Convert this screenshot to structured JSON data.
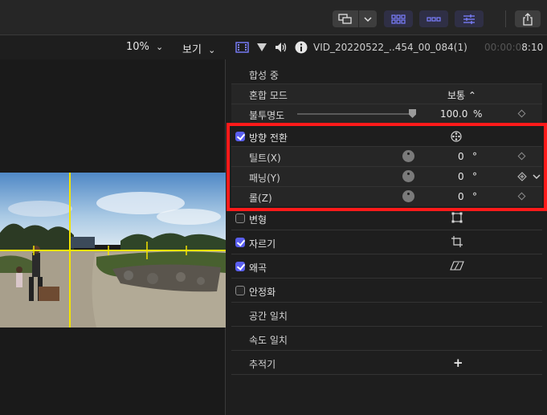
{
  "viewer": {
    "zoom": "10%",
    "zoom_caret": "⌄",
    "view_menu": "보기",
    "view_caret": "⌄"
  },
  "inspector": {
    "clip_name": "VID_20220522_..454_00_084(1)",
    "timecode_dim": "00:00:0",
    "timecode_bright": "8:10",
    "compositing": {
      "title": "합성 중",
      "blend_mode_label": "혼합 모드",
      "blend_mode_value": "보통 ⌃",
      "opacity_label": "불투명도",
      "opacity_value": "100.0",
      "opacity_unit": "%",
      "opacity_level": 1.0
    },
    "orientation": {
      "label": "방향 전환",
      "checked": true,
      "tilt_label": "틸트(X)",
      "tilt_value": "0",
      "pan_label": "패닝(Y)",
      "pan_value": "0",
      "roll_label": "롤(Z)",
      "roll_value": "0",
      "unit": "°"
    },
    "transform": {
      "label": "변형",
      "checked": false
    },
    "crop": {
      "label": "자르기",
      "checked": true
    },
    "distort": {
      "label": "왜곡",
      "checked": true
    },
    "stabilization": {
      "label": "안정화",
      "checked": false
    },
    "spatial_conform": "공간 일치",
    "rate_conform": "속도 일치",
    "tracker": "추적기",
    "tracker_add": "+"
  },
  "colors": {
    "accent": "#5a5ff0",
    "highlight": "#ff1a1a",
    "guide": "#f4e400"
  }
}
